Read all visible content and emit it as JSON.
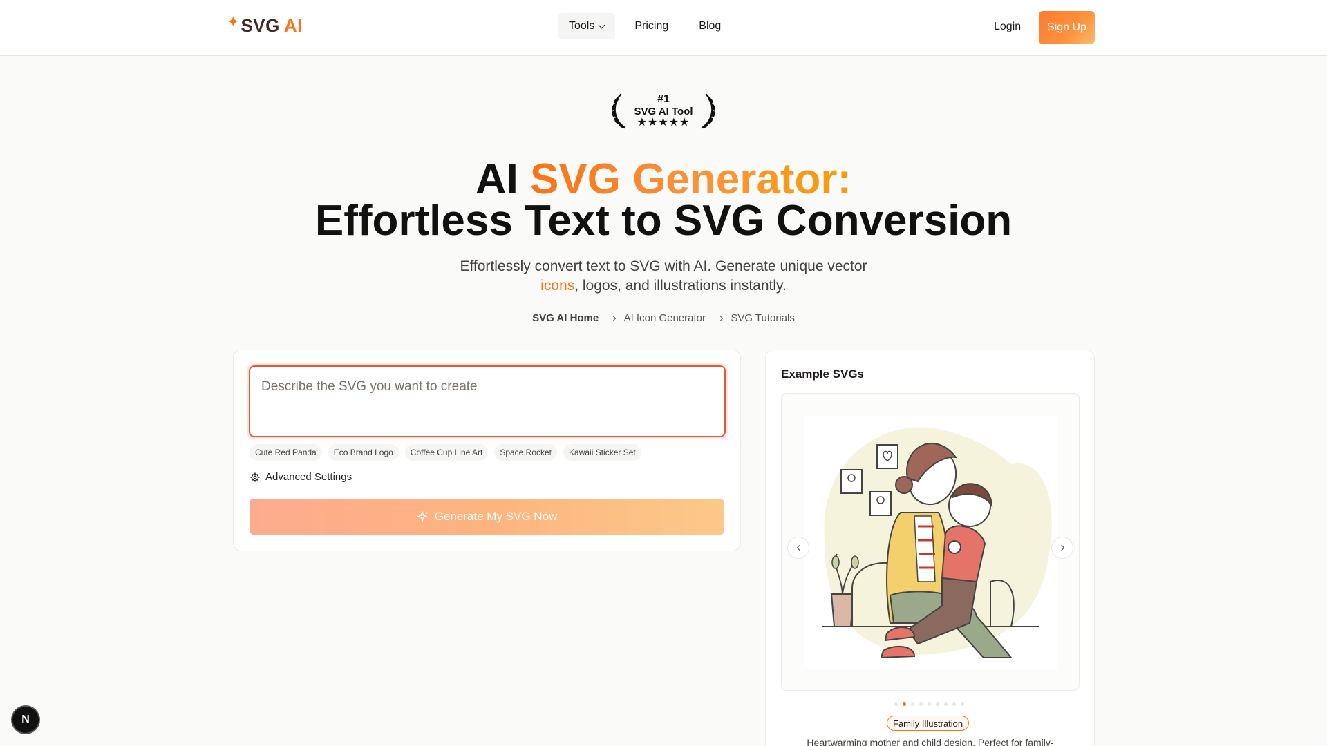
{
  "header": {
    "logo_text": "SVG",
    "logo_accent": "AI",
    "nav": [
      {
        "label": "Tools"
      },
      {
        "label": "Pricing"
      },
      {
        "label": "Blog"
      }
    ],
    "login_label": "Login",
    "signup_label": "Sign Up"
  },
  "badge": {
    "line1": "#1",
    "line2": "SVG AI Tool",
    "stars": "★★★★★"
  },
  "hero": {
    "title_part1": "AI ",
    "title_accent": "SVG Generator:",
    "title_line2": "Effortless Text to SVG Conversion",
    "subtitle_part1": "Effortlessly convert text to SVG with AI. Generate unique vector",
    "subtitle_link": "icons",
    "subtitle_part2": ", logos, and illustrations instantly."
  },
  "breadcrumbs": [
    "SVG AI Home",
    "AI Icon Generator",
    "SVG Tutorials"
  ],
  "generator": {
    "prompt_placeholder": "Describe the SVG you want to create",
    "prompt_value": "",
    "suggestions": [
      "Cute Red Panda",
      "Eco Brand Logo",
      "Coffee Cup Line Art",
      "Space Rocket",
      "Kawaii Sticker Set"
    ],
    "advanced_label": "Advanced Settings",
    "generate_label": "Generate My SVG Now"
  },
  "examples": {
    "title": "Example SVGs",
    "current_slide": 2,
    "slide_count": 9,
    "tag": "Family Illustration",
    "description": "Heartwarming mother and child design. Perfect for family-"
  },
  "dev_badge": "N",
  "colors": {
    "accent": "#f97316",
    "prompt_border": "#e05a3a"
  }
}
